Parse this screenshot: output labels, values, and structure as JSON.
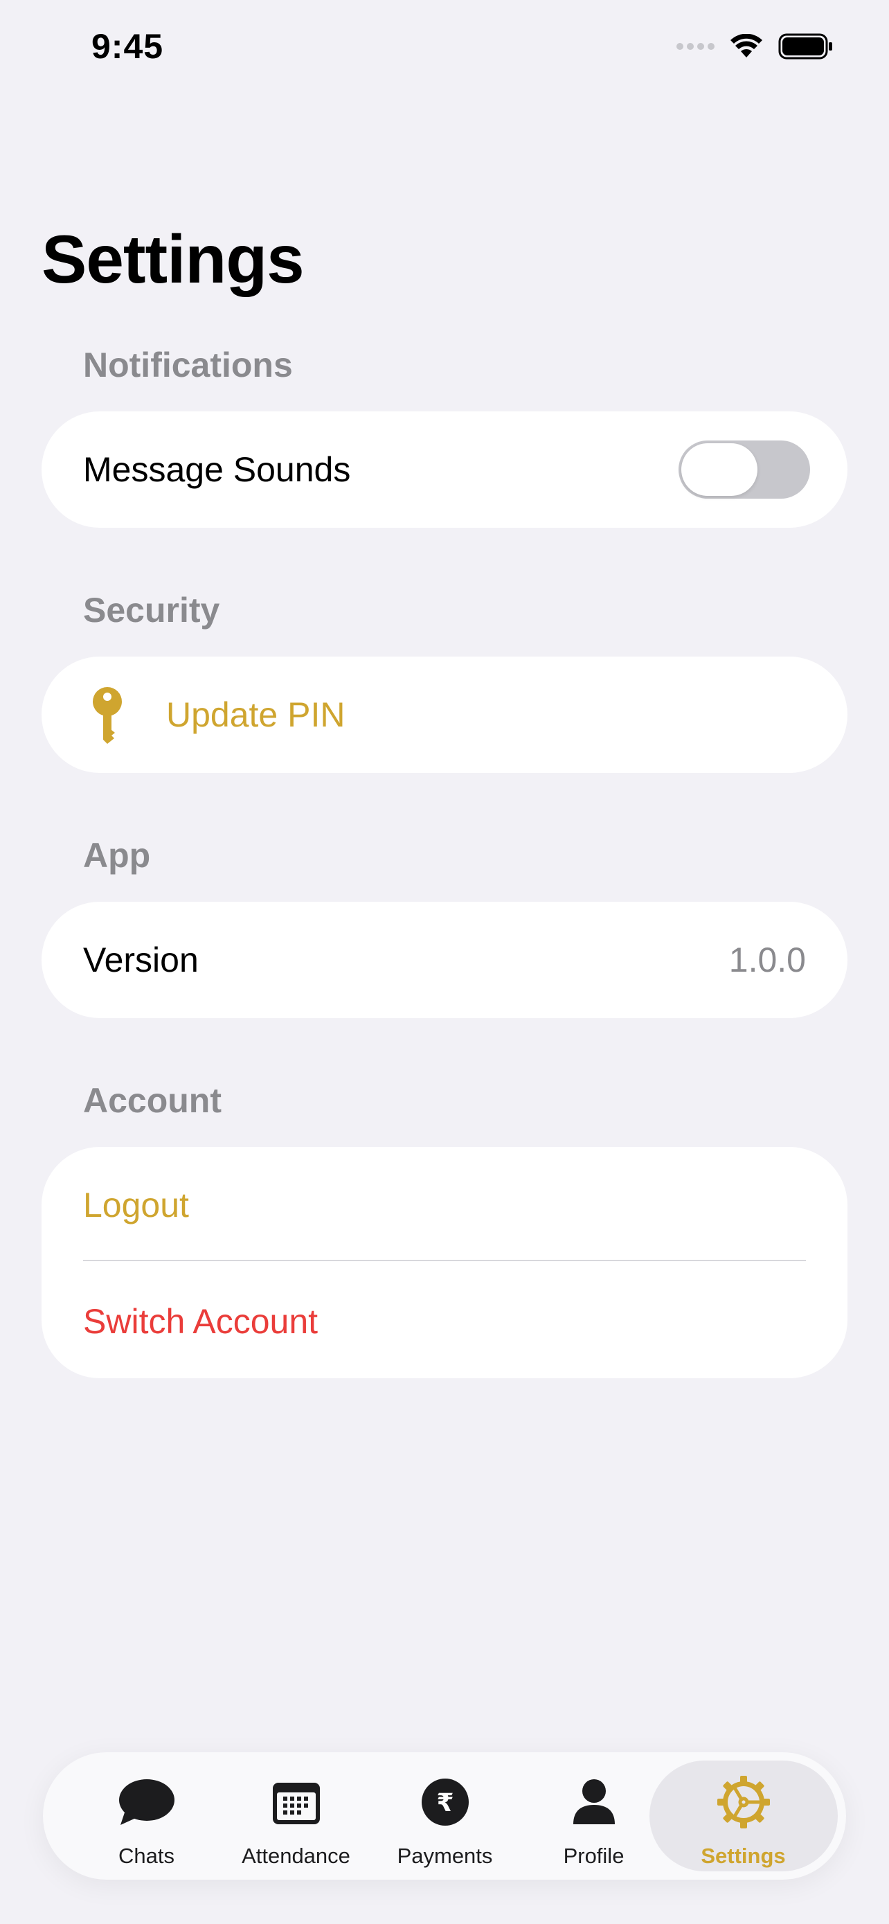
{
  "status_bar": {
    "time": "9:45"
  },
  "page": {
    "title": "Settings"
  },
  "sections": {
    "notifications": {
      "header": "Notifications",
      "message_sounds": {
        "label": "Message Sounds",
        "enabled": false
      }
    },
    "security": {
      "header": "Security",
      "update_pin": {
        "label": "Update PIN",
        "icon": "key-icon"
      }
    },
    "app": {
      "header": "App",
      "version": {
        "label": "Version",
        "value": "1.0.0"
      }
    },
    "account": {
      "header": "Account",
      "logout": "Logout",
      "switch_account": "Switch Account"
    }
  },
  "tab_bar": {
    "selected": "settings",
    "tabs": [
      {
        "id": "chats",
        "label": "Chats",
        "icon": "chat-bubble-icon"
      },
      {
        "id": "attendance",
        "label": "Attendance",
        "icon": "calendar-icon"
      },
      {
        "id": "payments",
        "label": "Payments",
        "icon": "rupee-icon"
      },
      {
        "id": "profile",
        "label": "Profile",
        "icon": "person-icon"
      },
      {
        "id": "settings",
        "label": "Settings",
        "icon": "gear-icon"
      }
    ]
  },
  "colors": {
    "accent": "#CFA52F",
    "destructive": "#EA3D3A",
    "background": "#F2F1F6",
    "secondary_text": "#8A8A8E"
  }
}
